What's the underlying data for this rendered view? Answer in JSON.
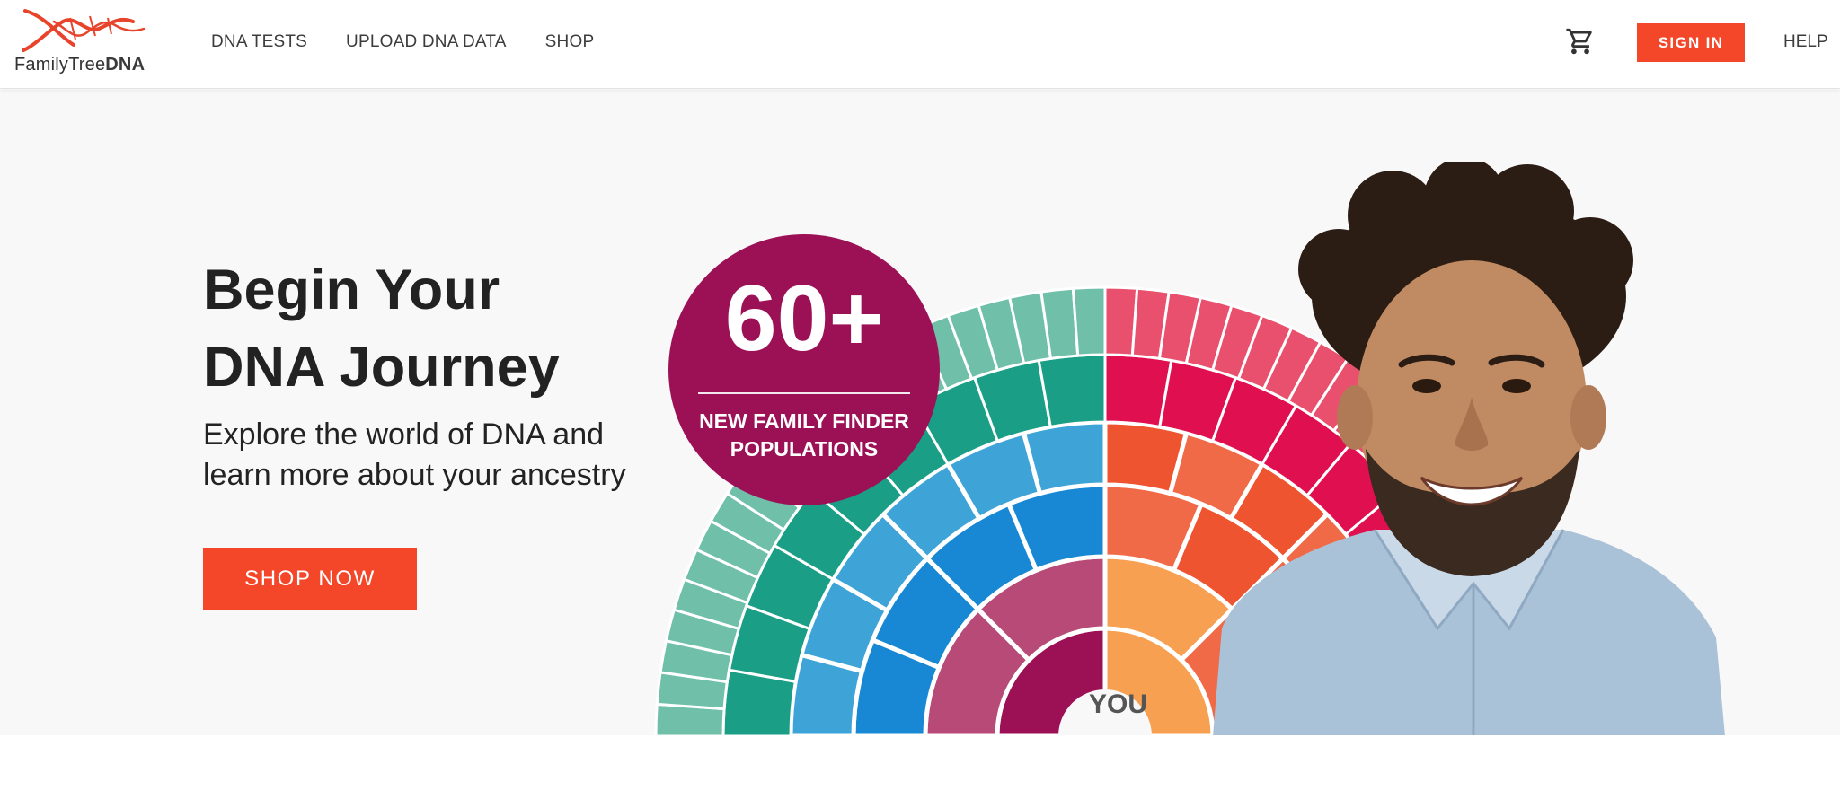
{
  "brand": {
    "name_light": "FamilyTree",
    "name_bold": "DNA",
    "accent_color": "#f4472a"
  },
  "nav": {
    "items": [
      {
        "label": "DNA TESTS"
      },
      {
        "label": "UPLOAD DNA DATA"
      },
      {
        "label": "SHOP"
      }
    ]
  },
  "header_actions": {
    "cart_icon": "cart-icon",
    "sign_in_label": "SIGN IN",
    "help_label": "HELP"
  },
  "hero": {
    "title_line1": "Begin Your",
    "title_line2": "DNA Journey",
    "subtitle_line1": "Explore the world of DNA and",
    "subtitle_line2": "learn more about your ancestry",
    "cta_label": "SHOP NOW",
    "badge": {
      "number": "60+",
      "label_line1": "NEW FAMILY FINDER",
      "label_line2": "POPULATIONS",
      "color": "#9c1156"
    },
    "fan_chart": {
      "center_label": "YOU",
      "colors": {
        "teal_dark": "#1a9e86",
        "teal_light": "#6fbfa9",
        "blue_dark": "#1888d4",
        "blue_light": "#3ea4d8",
        "magenta": "#9c1156",
        "rose": "#b84a78",
        "crimson": "#e01050",
        "pink": "#e8506d",
        "orange_dark": "#ee5430",
        "orange": "#f06a48",
        "orange_light": "#f8a052"
      }
    }
  }
}
